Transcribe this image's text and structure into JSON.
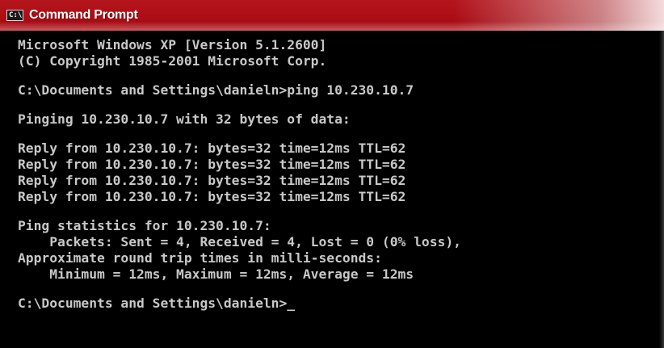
{
  "window": {
    "title": "Command Prompt",
    "icon": "cmd-icon",
    "icon_label": "C:\\"
  },
  "console": {
    "version_line": "Microsoft Windows XP [Version 5.1.2600]",
    "copyright_line": "(C) Copyright 1985-2001 Microsoft Corp.",
    "command_line": "C:\\Documents and Settings\\danieln>ping 10.230.10.7",
    "pinging_line": "Pinging 10.230.10.7 with 32 bytes of data:",
    "replies": [
      "Reply from 10.230.10.7: bytes=32 time=12ms TTL=62",
      "Reply from 10.230.10.7: bytes=32 time=12ms TTL=62",
      "Reply from 10.230.10.7: bytes=32 time=12ms TTL=62",
      "Reply from 10.230.10.7: bytes=32 time=12ms TTL=62"
    ],
    "stats_header": "Ping statistics for 10.230.10.7:",
    "packets_line": "    Packets: Sent = 4, Received = 4, Lost = 0 (0% loss),",
    "rtt_header": "Approximate round trip times in milli-seconds:",
    "rtt_line": "    Minimum = 12ms, Maximum = 12ms, Average = 12ms",
    "prompt": "C:\\Documents and Settings\\danieln>",
    "cursor": "_"
  }
}
